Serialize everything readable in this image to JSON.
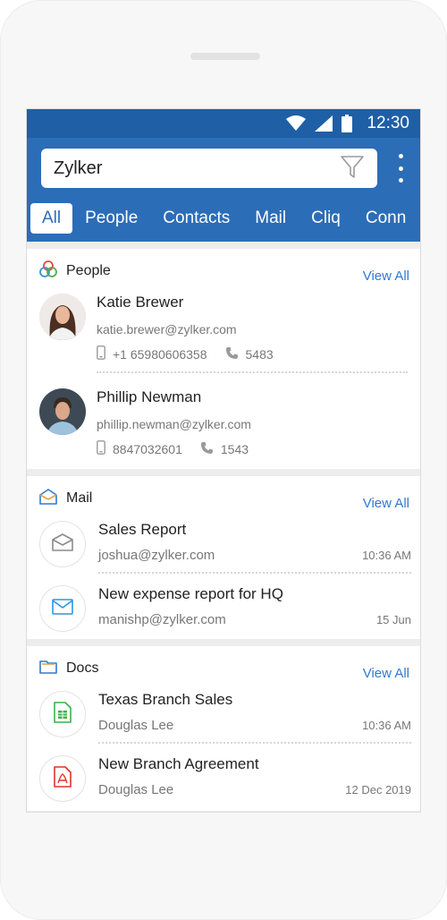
{
  "status_bar": {
    "time": "12:30"
  },
  "search": {
    "value": "Zylker"
  },
  "tabs": [
    "All",
    "People",
    "Contacts",
    "Mail",
    "Cliq",
    "Conn"
  ],
  "people": {
    "title": "People",
    "view_all": "View All",
    "items": [
      {
        "name": "Katie Brewer",
        "email": "katie.brewer@zylker.com",
        "mobile": "+1 65980606358",
        "extension": "5483"
      },
      {
        "name": "Phillip Newman",
        "email": "phillip.newman@zylker.com",
        "mobile": "8847032601",
        "extension": "1543"
      }
    ]
  },
  "mail": {
    "title": "Mail",
    "view_all": "View All",
    "items": [
      {
        "subject": "Sales Report",
        "from": "joshua@zylker.com",
        "time": "10:36 AM",
        "icon": "envelope-open-icon"
      },
      {
        "subject": "New expense report for HQ",
        "from": "manishp@zylker.com",
        "time": "15 Jun",
        "icon": "envelope-icon"
      }
    ]
  },
  "docs": {
    "title": "Docs",
    "view_all": "View All",
    "items": [
      {
        "name": "Texas Branch Sales",
        "owner": "Douglas Lee",
        "time": "10:36 AM",
        "icon": "spreadsheet-icon"
      },
      {
        "name": "New Branch Agreement",
        "owner": "Douglas Lee",
        "time": "12 Dec 2019",
        "icon": "pdf-icon"
      }
    ]
  },
  "colors": {
    "status_bar": "#1f5fa6",
    "app_bar": "#2c6db7",
    "link": "#2f7ad1",
    "spreadsheet_green": "#3bb04a",
    "pdf_red": "#e0342c"
  }
}
